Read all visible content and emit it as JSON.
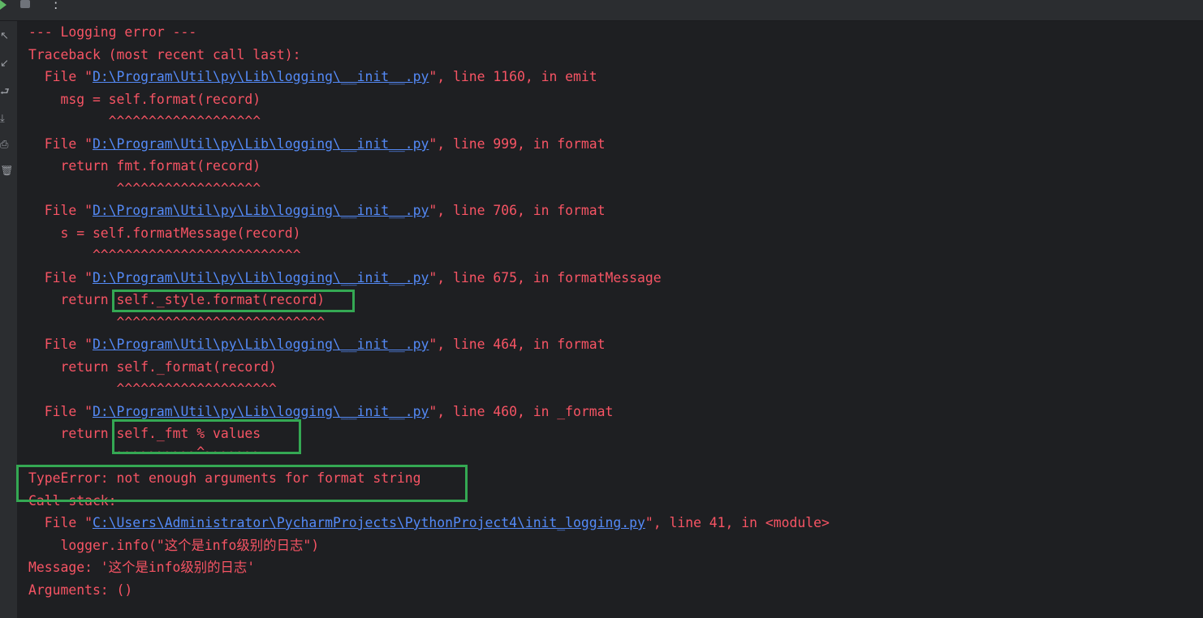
{
  "toolbar": {
    "run_icon": "run-icon",
    "stop_icon": "stop-icon",
    "more_label": ":"
  },
  "sidebar": {
    "icons": [
      "up-arrow-icon",
      "down-arrow-icon",
      "soft-wrap-icon",
      "scroll-to-end-icon",
      "print-icon",
      "trash-icon"
    ]
  },
  "console": {
    "lines": [
      {
        "text": "--- Logging error ---"
      },
      {
        "text": "Traceback (most recent call last):"
      },
      {
        "prefix": "  File \"",
        "link": "D:\\Program\\Util\\py\\Lib\\logging\\__init__.py",
        "suffix": "\", line 1160, in emit"
      },
      {
        "text": "    msg = self.format(record)"
      },
      {
        "text": "          ^^^^^^^^^^^^^^^^^^^"
      },
      {
        "prefix": "  File \"",
        "link": "D:\\Program\\Util\\py\\Lib\\logging\\__init__.py",
        "suffix": "\", line 999, in format"
      },
      {
        "text": "    return fmt.format(record)"
      },
      {
        "text": "           ^^^^^^^^^^^^^^^^^^"
      },
      {
        "prefix": "  File \"",
        "link": "D:\\Program\\Util\\py\\Lib\\logging\\__init__.py",
        "suffix": "\", line 706, in format"
      },
      {
        "text": "    s = self.formatMessage(record)"
      },
      {
        "text": "        ^^^^^^^^^^^^^^^^^^^^^^^^^^"
      },
      {
        "prefix": "  File \"",
        "link": "D:\\Program\\Util\\py\\Lib\\logging\\__init__.py",
        "suffix": "\", line 675, in formatMessage"
      },
      {
        "text": "    return self._style.format(record)"
      },
      {
        "text": "           ^^^^^^^^^^^^^^^^^^^^^^^^^^"
      },
      {
        "prefix": "  File \"",
        "link": "D:\\Program\\Util\\py\\Lib\\logging\\__init__.py",
        "suffix": "\", line 464, in format"
      },
      {
        "text": "    return self._format(record)"
      },
      {
        "text": "           ^^^^^^^^^^^^^^^^^^^^"
      },
      {
        "prefix": "  File \"",
        "link": "D:\\Program\\Util\\py\\Lib\\logging\\__init__.py",
        "suffix": "\", line 460, in _format"
      },
      {
        "text": "    return self._fmt % values"
      },
      {
        "text": "           ~~~~~~~~~~^~~~~~~~"
      },
      {
        "text": "TypeError: not enough arguments for format string"
      },
      {
        "text": "Call stack:"
      },
      {
        "prefix": "  File \"",
        "link": "C:\\Users\\Administrator\\PycharmProjects\\PythonProject4\\init_logging.py",
        "suffix": "\", line 41, in <module>"
      },
      {
        "text": "    logger.info(\"这个是info级别的日志\")"
      },
      {
        "text": "Message: '这个是info级别的日志'"
      },
      {
        "text": "Arguments: ()"
      }
    ]
  },
  "annotations": {
    "box_color": "#34a853"
  }
}
